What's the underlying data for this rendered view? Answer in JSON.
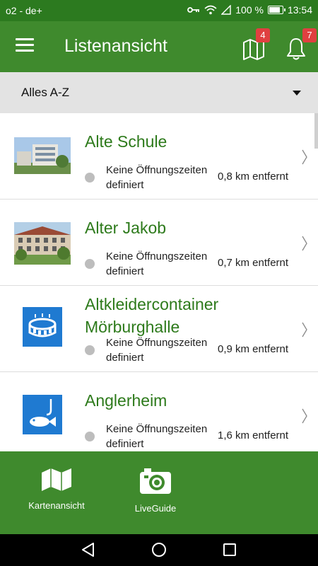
{
  "status_bar": {
    "carrier": "o2 - de+",
    "battery": "100 %",
    "time": "13:54",
    "icons": [
      "key-icon",
      "wifi-icon",
      "signal-icon",
      "battery-icon"
    ]
  },
  "app_bar": {
    "title": "Listenansicht",
    "map_badge": "4",
    "notifications_badge": "7"
  },
  "filter": {
    "selected": "Alles A-Z"
  },
  "list": {
    "items": [
      {
        "name": "Alte Schule",
        "hours_line1": "Keine Öffnungszeiten",
        "hours_line2": "definiert",
        "distance": "0,8 km entfernt",
        "thumb": "photo-building"
      },
      {
        "name": "Alter Jakob",
        "hours_line1": "Keine Öffnungszeiten",
        "hours_line2": "definiert",
        "distance": "0,7 km entfernt",
        "thumb": "photo-building"
      },
      {
        "name_line1": "Altkleidercontainer",
        "name_line2": "Mörburghalle",
        "hours_line1": "Keine Öffnungszeiten",
        "hours_line2": "definiert",
        "distance": "0,9 km entfernt",
        "thumb": "stadium-icon"
      },
      {
        "name": "Anglerheim",
        "hours_line1": "Keine Öffnungszeiten",
        "hours_line2": "definiert",
        "distance": "1,6 km entfernt",
        "thumb": "fishing-icon"
      }
    ]
  },
  "bottom_nav": {
    "items": [
      {
        "label": "Kartenansicht",
        "icon": "map-icon"
      },
      {
        "label": "LiveGuide",
        "icon": "camera-icon"
      }
    ]
  },
  "colors": {
    "primary": "#3f8a2d",
    "status": "#2c7a1f",
    "accent_text": "#2d7a1b",
    "badge": "#e04040"
  }
}
